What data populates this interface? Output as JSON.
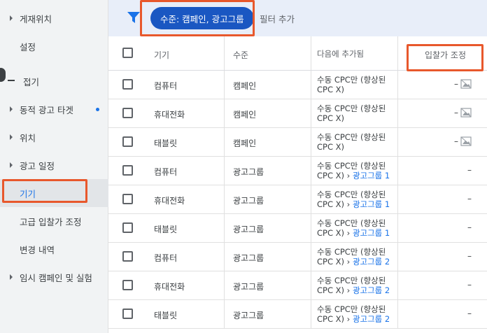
{
  "sidebar": {
    "items": [
      {
        "label": "게재위치",
        "caret": true
      },
      {
        "label": "설정",
        "caret": false
      },
      {
        "label": "접기",
        "caret": false
      },
      {
        "label": "동적 광고 타겟",
        "caret": true,
        "dot": true
      },
      {
        "label": "위치",
        "caret": true
      },
      {
        "label": "광고 일정",
        "caret": true
      },
      {
        "label": "기기",
        "caret": false,
        "active": true
      },
      {
        "label": "고급 입찰가 조정",
        "caret": false
      },
      {
        "label": "변경 내역",
        "caret": false
      },
      {
        "label": "임시 캠페인 및 실험",
        "caret": true
      }
    ]
  },
  "filter": {
    "chip_label": "수준: 캠페인, 광고그룹",
    "add_label": "필터 추가"
  },
  "table": {
    "headers": {
      "device": "기기",
      "level": "수준",
      "added_to": "다음에 추가됨",
      "bid_adj": "입찰가 조정"
    },
    "rows": [
      {
        "device": "컴퓨터",
        "level": "캠페인",
        "added": "수동 CPC만 (향상된 CPC X)",
        "link": "",
        "bid": "–",
        "bid_icon": true
      },
      {
        "device": "휴대전화",
        "level": "캠페인",
        "added": "수동 CPC만 (향상된 CPC X)",
        "link": "",
        "bid": "–",
        "bid_icon": true
      },
      {
        "device": "태블릿",
        "level": "캠페인",
        "added": "수동 CPC만 (향상된 CPC X)",
        "link": "",
        "bid": "–",
        "bid_icon": true
      },
      {
        "device": "컴퓨터",
        "level": "광고그룹",
        "added": "수동 CPC만 (향상된 CPC X) ›",
        "link": "광고그룹 1",
        "bid": "–",
        "bid_icon": false
      },
      {
        "device": "휴대전화",
        "level": "광고그룹",
        "added": "수동 CPC만 (향상된 CPC X) ›",
        "link": "광고그룹 1",
        "bid": "–",
        "bid_icon": false
      },
      {
        "device": "태블릿",
        "level": "광고그룹",
        "added": "수동 CPC만 (향상된 CPC X) ›",
        "link": "광고그룹 1",
        "bid": "–",
        "bid_icon": false
      },
      {
        "device": "컴퓨터",
        "level": "광고그룹",
        "added": "수동 CPC만 (향상된 CPC X) ›",
        "link": "광고그룹 2",
        "bid": "–",
        "bid_icon": false
      },
      {
        "device": "휴대전화",
        "level": "광고그룹",
        "added": "수동 CPC만 (향상된 CPC X) ›",
        "link": "광고그룹 2",
        "bid": "–",
        "bid_icon": false
      },
      {
        "device": "태블릿",
        "level": "광고그룹",
        "added": "수동 CPC만 (향상된 CPC X) ›",
        "link": "광고그룹 2",
        "bid": "–",
        "bid_icon": false
      }
    ]
  },
  "icons": {
    "filter": "filter-icon",
    "checkbox": "checkbox-icon",
    "bid_image": "image-icon"
  },
  "colors": {
    "accent": "#1a73e8",
    "chip": "#1a57c2",
    "highlight": "#e8582c"
  }
}
